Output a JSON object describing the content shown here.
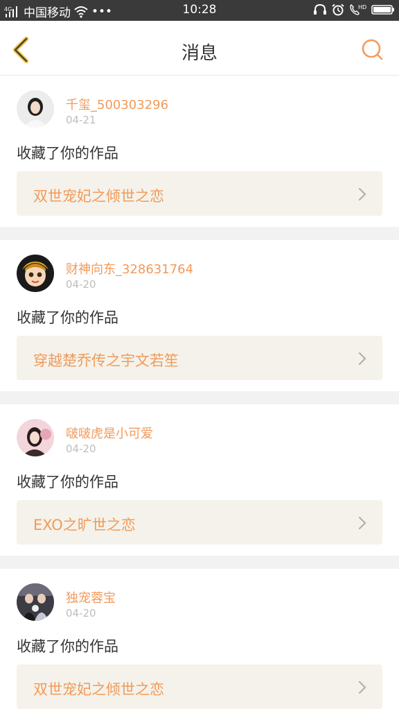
{
  "statusbar": {
    "network": "4G",
    "carrier": "中国移动",
    "dots": "•••",
    "time": "10:28",
    "hd": "HD"
  },
  "nav": {
    "title": "消息",
    "accent_color": "#f29a5a",
    "back_icon": "chevron-left-icon",
    "search_icon": "search-icon"
  },
  "messages": [
    {
      "username": "千玺_500303296",
      "date": "04-21",
      "action": "收藏了你的作品",
      "work_title": "双世宠妃之倾世之恋"
    },
    {
      "username": "财神向东_328631764",
      "date": "04-20",
      "action": "收藏了你的作品",
      "work_title": "穿越楚乔传之宇文若笙"
    },
    {
      "username": "啵啵虎是小可爱",
      "date": "04-20",
      "action": "收藏了你的作品",
      "work_title": "EXO之旷世之恋"
    },
    {
      "username": "独宠蓉宝",
      "date": "04-20",
      "action": "收藏了你的作品",
      "work_title": "双世宠妃之倾世之恋"
    }
  ]
}
